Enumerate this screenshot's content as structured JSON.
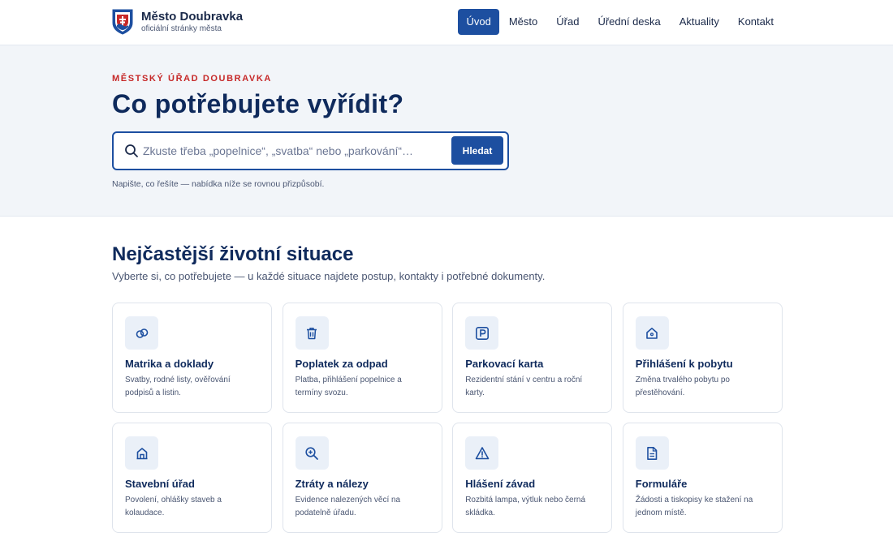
{
  "header": {
    "brand_name": "Město Doubravka",
    "brand_sub": "oficiální stránky města",
    "nav": [
      {
        "label": "Úvod",
        "active": true
      },
      {
        "label": "Město"
      },
      {
        "label": "Úřad"
      },
      {
        "label": "Úřední deska"
      },
      {
        "label": "Aktuality"
      },
      {
        "label": "Kontakt"
      }
    ]
  },
  "hero": {
    "eyebrow": "MĚSTSKÝ ÚŘAD DOUBRAVKA",
    "title": "Co potřebujete vyřídit?",
    "search": {
      "placeholder": "Zkuste třeba „popelnice“, „svatba“ nebo „parkování“…",
      "value": "",
      "button_label": "Hledat",
      "icon": "search-icon"
    },
    "hint": "Napište, co řešíte — nabídka níže se rovnou přizpůsobí."
  },
  "section": {
    "title": "Nejčastější životní situace",
    "subtitle": "Vyberte si, co potřebujete — u každé situace najdete postup, kontakty i potřebné dokumenty.",
    "cards": [
      {
        "title": "Matrika a doklady",
        "desc": "Svatby, rodné listy, ověřování podpisů a listin.",
        "icon": "rings-icon"
      },
      {
        "title": "Poplatek za odpad",
        "desc": "Platba, přihlášení popelnice a termíny svozu.",
        "icon": "trash-icon"
      },
      {
        "title": "Parkovací karta",
        "desc": "Rezidentní stání v centru a roční karty.",
        "icon": "parking-icon"
      },
      {
        "title": "Přihlášení k pobytu",
        "desc": "Změna trvalého pobytu po přestěhování.",
        "icon": "home-icon"
      },
      {
        "title": "Stavební úřad",
        "desc": "Povolení, ohlášky staveb a kolaudace.",
        "icon": "building-icon"
      },
      {
        "title": "Ztráty a nálezy",
        "desc": "Evidence nalezených věcí na podatelně úřadu.",
        "icon": "magnifier-icon"
      },
      {
        "title": "Hlášení závad",
        "desc": "Rozbitá lampa, výtluk nebo černá skládka.",
        "icon": "warning-icon"
      },
      {
        "title": "Formuláře",
        "desc": "Žádosti a tiskopisy ke stažení na jednom místě.",
        "icon": "document-icon"
      }
    ]
  },
  "colors": {
    "primary": "#1d4fa0",
    "heading": "#0f2a5c",
    "eyebrow": "#c62828",
    "hero_bg": "#f2f5f9",
    "icon_bg": "#eaf0f8"
  }
}
